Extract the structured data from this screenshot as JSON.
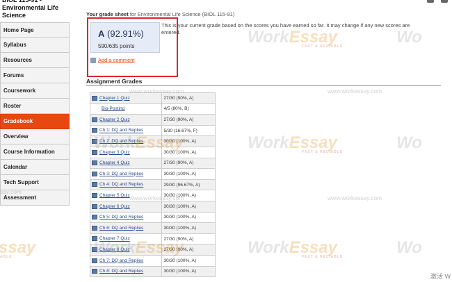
{
  "sidebar": {
    "course_title": "BIOL 115-91 - Environmental Life Science",
    "items": [
      {
        "label": "Home Page",
        "active": false
      },
      {
        "label": "Syllabus",
        "active": false
      },
      {
        "label": "Resources",
        "active": false
      },
      {
        "label": "Forums",
        "active": false
      },
      {
        "label": "Coursework",
        "active": false
      },
      {
        "label": "Roster",
        "active": false
      },
      {
        "label": "Gradebook",
        "active": true
      },
      {
        "label": "Overview",
        "active": false
      },
      {
        "label": "Course Information",
        "active": false
      },
      {
        "label": "Calendar",
        "active": false
      },
      {
        "label": "Tech Support",
        "active": false
      },
      {
        "label": "Assessment",
        "active": false
      }
    ],
    "active_color": "#e8480f"
  },
  "gradesheet": {
    "title_bold": "Your grade sheet",
    "title_rest": "for Environmental Life Science (BIOL 115-91)",
    "grade_letter": "A",
    "grade_percent": "(92.91%)",
    "points": "590/635 points",
    "note": "This is your current grade based on the scores you have earned so far. It may change if any new scores are entered.",
    "add_comment": "Add a comment"
  },
  "assignments": {
    "title": "Assignment Grades",
    "rows": [
      {
        "name": "Chapter 1 Quiz",
        "score": "27/30 (90%, A)",
        "icon": "quiz-icon"
      },
      {
        "name": "Bio-Posting",
        "score": "4/5 (80%, B)",
        "icon": ""
      },
      {
        "name": "Chapter 2 Quiz",
        "score": "27/30 (90%, A)",
        "icon": "quiz-icon"
      },
      {
        "name": "Ch 1: DQ and Replies",
        "score": "5/30 (16.67%, F)",
        "icon": "forum-icon"
      },
      {
        "name": "Ch 2: DQ and Replies",
        "score": "30/30 (100%, A)",
        "icon": "forum-icon"
      },
      {
        "name": "Chapter 3 Quiz",
        "score": "30/30 (100%, A)",
        "icon": "quiz-icon"
      },
      {
        "name": "Chapter 4 Quiz",
        "score": "27/30 (90%, A)",
        "icon": "quiz-icon"
      },
      {
        "name": "Ch 3: DQ and Replies",
        "score": "30/30 (100%, A)",
        "icon": "forum-icon"
      },
      {
        "name": "Ch 4: DQ and Replies",
        "score": "29/30 (96.67%, A)",
        "icon": "forum-icon"
      },
      {
        "name": "Chapter 5 Quiz",
        "score": "30/30 (100%, A)",
        "icon": "quiz-icon"
      },
      {
        "name": "Chapter 6 Quiz",
        "score": "30/30 (100%, A)",
        "icon": "quiz-icon"
      },
      {
        "name": "Ch 5: DQ and Replies",
        "score": "30/30 (100%, A)",
        "icon": "forum-icon"
      },
      {
        "name": "Ch 6: DQ and Replies",
        "score": "30/30 (100%, A)",
        "icon": "forum-icon"
      },
      {
        "name": "Chapter 7 Quiz",
        "score": "27/30 (90%, A)",
        "icon": "quiz-icon"
      },
      {
        "name": "Chapter 8 Quiz",
        "score": "27/30 (90%, A)",
        "icon": "quiz-icon"
      },
      {
        "name": "Ch 7: DQ and Replies",
        "score": "30/30 (100%, A)",
        "icon": "forum-icon"
      },
      {
        "name": "Ch 8: DQ and Replies",
        "score": "30/30 (100%, A)",
        "icon": "forum-icon"
      }
    ]
  },
  "watermark": {
    "brand_a": "Work",
    "brand_b": "Essay",
    "tagline": "FAST & RELIABLE",
    "url": "www.workessay.com",
    "url_partial_left": "say.com",
    "brand_partial_left": "ssay",
    "tagline_partial_left": "ABLE",
    "brand_right_partial": "Wo"
  },
  "system": {
    "activate_text": "激活 W"
  }
}
